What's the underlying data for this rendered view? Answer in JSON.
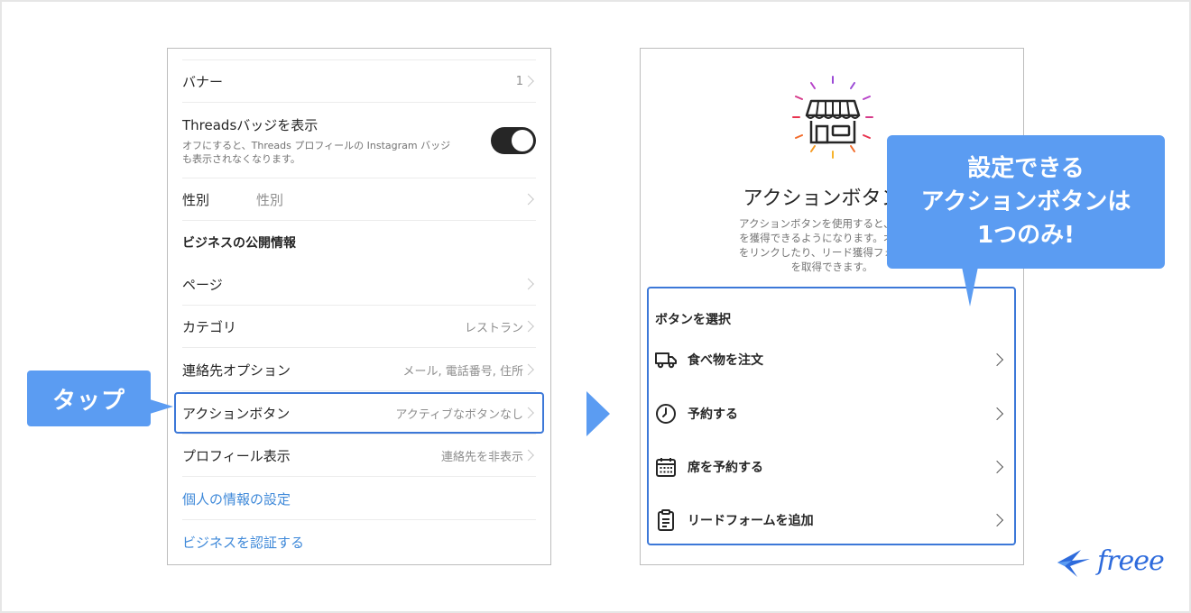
{
  "left_panel": {
    "rows": {
      "banner": {
        "label": "バナー",
        "value": "1"
      },
      "threads": {
        "title": "Threadsバッジを表示",
        "desc_line1": "オフにすると、Threads プロフィールの Instagram バッジ",
        "desc_line2": "も表示されなくなります。",
        "toggle_on": true
      },
      "gender": {
        "label": "性別",
        "value": "性別"
      },
      "section": {
        "label": "ビジネスの公開情報"
      },
      "page": {
        "label": "ページ"
      },
      "category": {
        "label": "カテゴリ",
        "value": "レストラン"
      },
      "contact": {
        "label": "連絡先オプション",
        "value": "メール, 電話番号, 住所"
      },
      "action": {
        "label": "アクションボタン",
        "value": "アクティブなボタンなし"
      },
      "profile": {
        "label": "プロフィール表示",
        "value": "連絡先を非表示"
      },
      "personal": {
        "label": "個人の情報の設定"
      },
      "verify": {
        "label": "ビジネスを認証する"
      }
    },
    "tap_label": "タップ"
  },
  "right_panel": {
    "heading": "アクションボタンを",
    "desc_lines": [
      "アクションボタンを使用すると、プロフ",
      "を獲得できるようになります。オンライ",
      "をリンクしたり、リード獲得フォームを",
      "を取得できます。"
    ],
    "select_title": "ボタンを選択",
    "options": [
      {
        "label": "食べ物を注文",
        "icon": "delivery-truck-icon"
      },
      {
        "label": "予約する",
        "icon": "clock-icon"
      },
      {
        "label": "席を予約する",
        "icon": "calendar-icon"
      },
      {
        "label": "リードフォームを追加",
        "icon": "clipboard-icon"
      }
    ]
  },
  "callout": {
    "line1": "設定できる",
    "line2": "アクションボタンは",
    "line3": "1つのみ!"
  },
  "logo": {
    "text": "freee"
  },
  "colors": {
    "accent": "#5b9cf2",
    "highlight": "#3c78d8",
    "link": "#3f89d9"
  }
}
